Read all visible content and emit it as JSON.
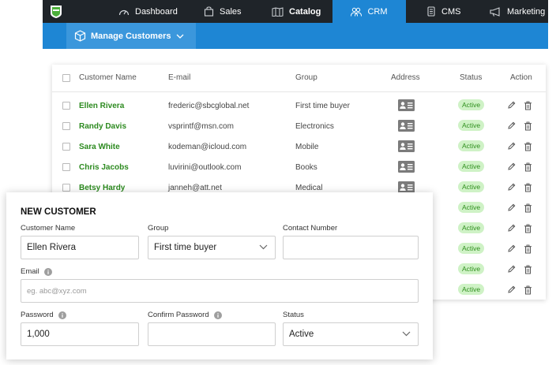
{
  "topnav": {
    "items": [
      {
        "label": "Dashboard",
        "icon": "gauge-icon",
        "active": false,
        "bold": false
      },
      {
        "label": "Sales",
        "icon": "bag-icon",
        "active": false,
        "bold": false
      },
      {
        "label": "Catalog",
        "icon": "book-icon",
        "active": false,
        "bold": true
      },
      {
        "label": "CRM",
        "icon": "people-icon",
        "active": true,
        "bold": false
      },
      {
        "label": "CMS",
        "icon": "document-icon",
        "active": false,
        "bold": false
      },
      {
        "label": "Marketing",
        "icon": "megaphone-icon",
        "active": false,
        "bold": false
      }
    ]
  },
  "subnav": {
    "label": "Manage Customers"
  },
  "table": {
    "headers": {
      "name": "Customer Name",
      "email": "E-mail",
      "group": "Group",
      "address": "Address",
      "status": "Status",
      "action": "Action"
    },
    "rows": [
      {
        "name": "Ellen Rivera",
        "email": "frederic@sbcglobal.net",
        "group": "First time buyer",
        "status": "Active"
      },
      {
        "name": "Randy Davis",
        "email": "vsprintf@msn.com",
        "group": "Electronics",
        "status": "Active"
      },
      {
        "name": "Sara White",
        "email": "kodeman@icloud.com",
        "group": "Mobile",
        "status": "Active"
      },
      {
        "name": "Chris Jacobs",
        "email": "luvirini@outlook.com",
        "group": "Books",
        "status": "Active"
      },
      {
        "name": "Betsy Hardy",
        "email": "janneh@att.net",
        "group": "Medical",
        "status": "Active"
      },
      {
        "name": "",
        "email": "",
        "group": "",
        "status": "Active"
      },
      {
        "name": "",
        "email": "",
        "group": "",
        "status": "Active"
      },
      {
        "name": "",
        "email": "",
        "group": "",
        "status": "Active"
      },
      {
        "name": "",
        "email": "",
        "group": "",
        "status": "Active"
      },
      {
        "name": "",
        "email": "",
        "group": "",
        "status": "Active"
      }
    ]
  },
  "form": {
    "title": "NEW CUSTOMER",
    "customer_name": {
      "label": "Customer Name",
      "value": "Ellen Rivera"
    },
    "group": {
      "label": "Group",
      "value": "First time buyer"
    },
    "contact": {
      "label": "Contact Number",
      "value": ""
    },
    "email": {
      "label": "Email",
      "placeholder": "eg. abc@xyz.com"
    },
    "password": {
      "label": "Password",
      "value": "1,000"
    },
    "confirm_password": {
      "label": "Confirm Password",
      "value": ""
    },
    "status": {
      "label": "Status",
      "value": "Active"
    }
  },
  "colors": {
    "nav_bg": "#1f2429",
    "accent": "#1e86d4",
    "name_green": "#2c8a1f",
    "badge_bg": "#cff2c6"
  }
}
